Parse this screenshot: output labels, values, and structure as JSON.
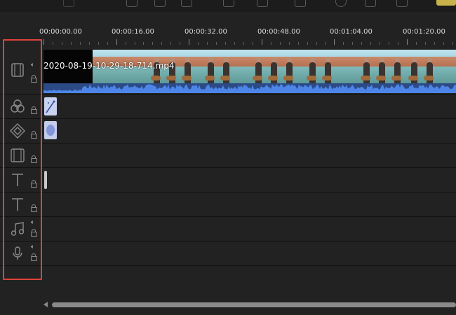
{
  "colors": {
    "background": "#222222",
    "highlight_box": "#e0423a",
    "waveform": "#4d86e8",
    "toolbar_accent": "#c8b24a"
  },
  "toolbar": {
    "icons": [
      "toolbar-icon",
      "toolbar-icon",
      "toolbar-icon",
      "toolbar-icon",
      "toolbar-icon",
      "toolbar-icon",
      "toolbar-icon",
      "toolbar-icon"
    ]
  },
  "ruler": {
    "labels": [
      "00:00:00.00",
      "00:00:16.00",
      "00:00:32.00",
      "00:00:48.00",
      "00:01:04.00",
      "00:01:20.00"
    ]
  },
  "tracks": [
    {
      "icon": "video-track-icon",
      "has_audio": true,
      "locked": true
    },
    {
      "icon": "effects-track-icon",
      "has_audio": false,
      "locked": true
    },
    {
      "icon": "overlay-track-icon",
      "has_audio": false,
      "locked": true
    },
    {
      "icon": "filter-track-icon",
      "has_audio": false,
      "locked": true
    },
    {
      "icon": "text-track-icon",
      "has_audio": false,
      "locked": true
    },
    {
      "icon": "text-track-icon",
      "has_audio": false,
      "locked": true
    },
    {
      "icon": "music-track-icon",
      "has_audio": true,
      "locked": true
    },
    {
      "icon": "voiceover-track-icon",
      "has_audio": true,
      "locked": true
    }
  ],
  "clip": {
    "filename": "2020-08-19-10-29-18-714.mp4"
  }
}
